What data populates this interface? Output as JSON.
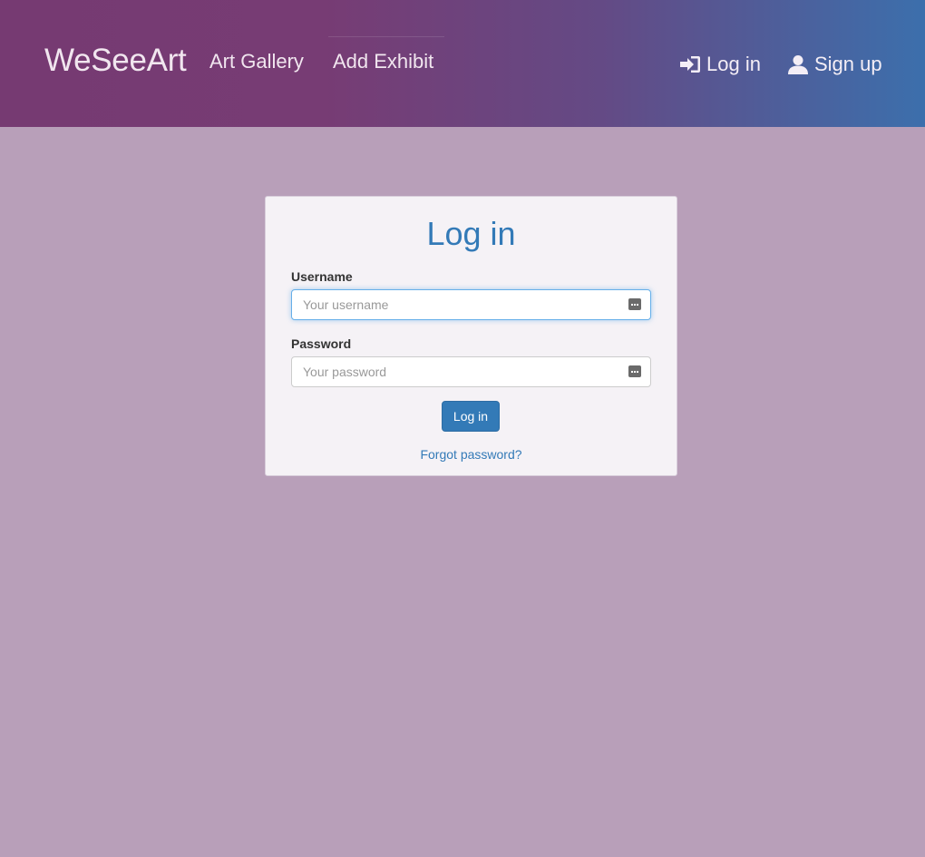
{
  "navbar": {
    "brand": "WeSeeArt",
    "links": [
      {
        "label": "Art Gallery"
      },
      {
        "label": "Add Exhibit"
      }
    ],
    "login": {
      "label": "Log in",
      "icon": "sign-in-icon"
    },
    "signup": {
      "label": "Sign up",
      "icon": "user-icon"
    }
  },
  "login_form": {
    "title": "Log in",
    "username": {
      "label": "Username",
      "placeholder": "Your username",
      "value": ""
    },
    "password": {
      "label": "Password",
      "placeholder": "Your password",
      "value": ""
    },
    "submit_label": "Log in",
    "forgot_label": "Forgot password?"
  },
  "colors": {
    "page_background": "#b89fb9",
    "navbar_gradient_start": "#763a72",
    "navbar_gradient_end": "#3c6fac",
    "primary": "#337ab7"
  }
}
